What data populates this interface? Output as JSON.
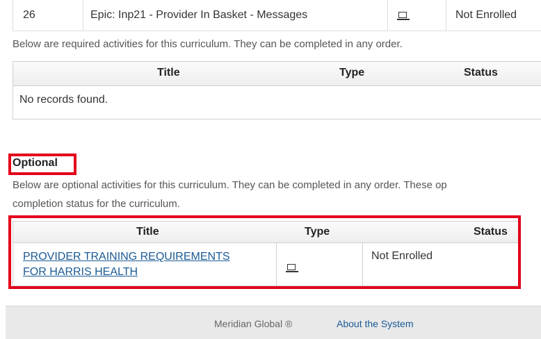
{
  "top_row": {
    "number": "26",
    "title": "Epic: Inp21 - Provider In Basket - Messages",
    "type_icon": "laptop-icon",
    "status": "Not Enrolled"
  },
  "required": {
    "description": "Below are required activities for this curriculum. They can be completed in any order.",
    "columns": {
      "title": "Title",
      "type": "Type",
      "status": "Status"
    },
    "empty_message": "No records found."
  },
  "optional": {
    "heading": "Optional",
    "description_line1": "Below are optional activities for this curriculum. They can be completed in any order. These op",
    "description_line2": "completion status for the curriculum.",
    "columns": {
      "title": "Title",
      "type": "Type",
      "status": "Status"
    },
    "rows": [
      {
        "title_line1": "PROVIDER TRAINING REQUIREMENTS",
        "title_line2": "FOR HARRIS HEALTH",
        "type_icon": "laptop-icon",
        "status": "Not Enrolled"
      }
    ]
  },
  "footer": {
    "brand": "Meridian Global ®",
    "about_link": "About the System"
  },
  "colors": {
    "highlight_red": "#e3001b",
    "link_blue": "#1a5a96",
    "footer_bg": "#e9e9e9"
  }
}
